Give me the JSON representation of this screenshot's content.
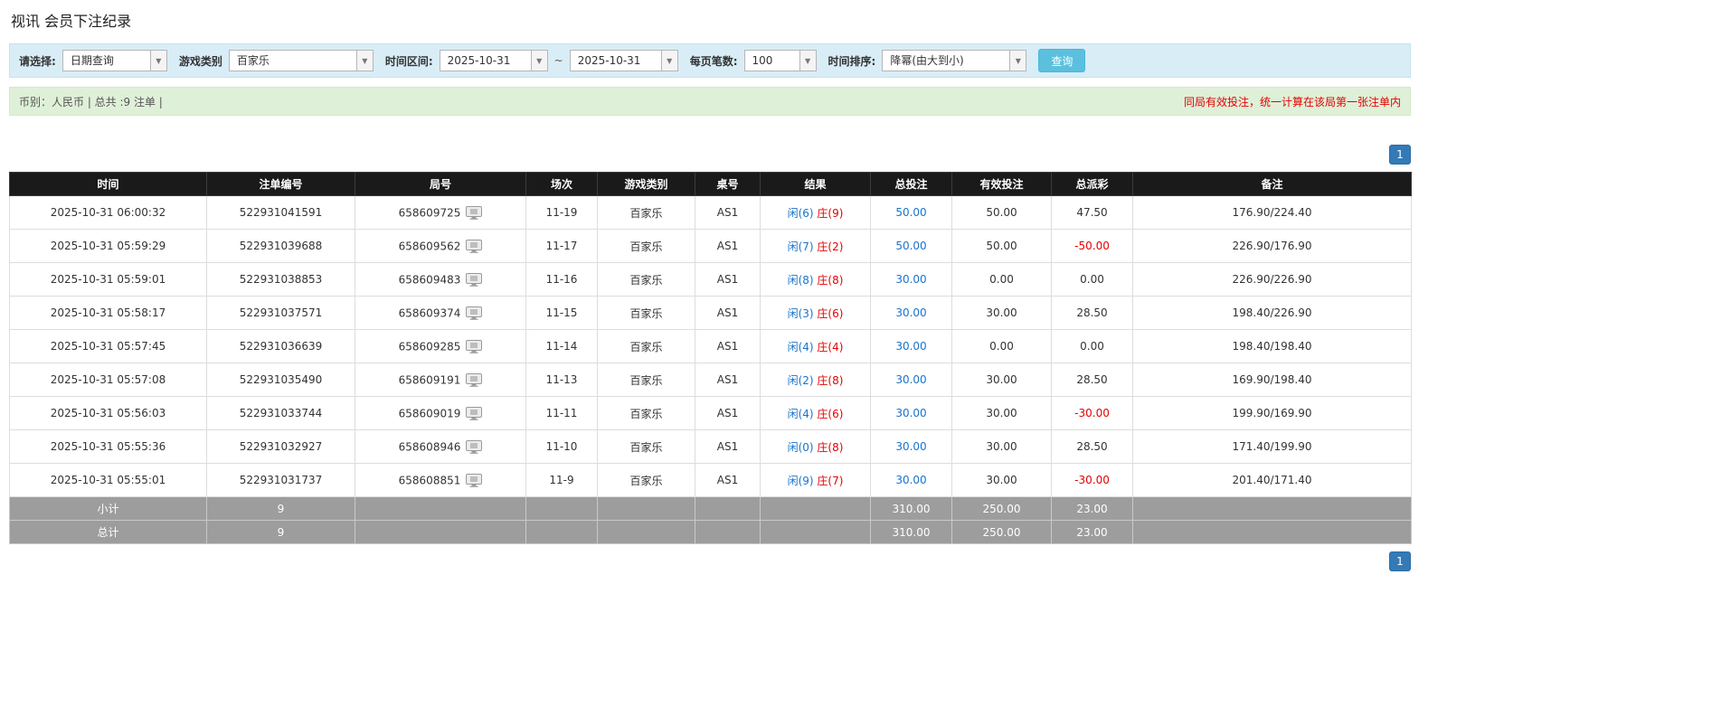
{
  "page": {
    "title": "视讯 会员下注纪录"
  },
  "colors": {
    "link_blue": "#1874cd",
    "banker_red": "#e60000",
    "header_bg": "#1a1a1a",
    "footer_bg": "#9d9d9d",
    "filter_bar_bg": "#d9edf7",
    "info_bar_bg": "#dff0d8",
    "search_button_bg": "#5bc0de",
    "pagination_bg": "#337ab7"
  },
  "filters": {
    "query_type": {
      "label": "请选择:",
      "value": "日期查询"
    },
    "game_type": {
      "label": "游戏类别",
      "value": "百家乐"
    },
    "date_range": {
      "label": "时间区间:",
      "from": "2025-10-31",
      "separator": "~",
      "to": "2025-10-31"
    },
    "page_size": {
      "label": "每页笔数:",
      "value": "100"
    },
    "sort_order": {
      "label": "时间排序:",
      "value": "降幂(由大到小)"
    },
    "search_button_label": "查询"
  },
  "info_bar": {
    "left": "币别：人民币 | 总共 :9 注单 |",
    "right": "同局有效投注，统一计算在该局第一张注单内"
  },
  "pagination": {
    "page": "1"
  },
  "table": {
    "headers": [
      "时间",
      "注单编号",
      "局号",
      "场次",
      "游戏类别",
      "桌号",
      "结果",
      "总投注",
      "有效投注",
      "总派彩",
      "备注"
    ],
    "rows": [
      {
        "time": "2025-10-31 06:00:32",
        "bet_id": "522931041591",
        "round_id": "658609725",
        "session": "11-19",
        "game": "百家乐",
        "table_no": "AS1",
        "result_player": "闲(6)",
        "result_banker": "庄(9)",
        "total_bet": "50.00",
        "valid_bet": "50.00",
        "payout": "47.50",
        "remark": "176.90/224.40"
      },
      {
        "time": "2025-10-31 05:59:29",
        "bet_id": "522931039688",
        "round_id": "658609562",
        "session": "11-17",
        "game": "百家乐",
        "table_no": "AS1",
        "result_player": "闲(7)",
        "result_banker": "庄(2)",
        "total_bet": "50.00",
        "valid_bet": "50.00",
        "payout": "-50.00",
        "remark": "226.90/176.90"
      },
      {
        "time": "2025-10-31 05:59:01",
        "bet_id": "522931038853",
        "round_id": "658609483",
        "session": "11-16",
        "game": "百家乐",
        "table_no": "AS1",
        "result_player": "闲(8)",
        "result_banker": "庄(8)",
        "total_bet": "30.00",
        "valid_bet": "0.00",
        "payout": "0.00",
        "remark": "226.90/226.90"
      },
      {
        "time": "2025-10-31 05:58:17",
        "bet_id": "522931037571",
        "round_id": "658609374",
        "session": "11-15",
        "game": "百家乐",
        "table_no": "AS1",
        "result_player": "闲(3)",
        "result_banker": "庄(6)",
        "total_bet": "30.00",
        "valid_bet": "30.00",
        "payout": "28.50",
        "remark": "198.40/226.90"
      },
      {
        "time": "2025-10-31 05:57:45",
        "bet_id": "522931036639",
        "round_id": "658609285",
        "session": "11-14",
        "game": "百家乐",
        "table_no": "AS1",
        "result_player": "闲(4)",
        "result_banker": "庄(4)",
        "total_bet": "30.00",
        "valid_bet": "0.00",
        "payout": "0.00",
        "remark": "198.40/198.40"
      },
      {
        "time": "2025-10-31 05:57:08",
        "bet_id": "522931035490",
        "round_id": "658609191",
        "session": "11-13",
        "game": "百家乐",
        "table_no": "AS1",
        "result_player": "闲(2)",
        "result_banker": "庄(8)",
        "total_bet": "30.00",
        "valid_bet": "30.00",
        "payout": "28.50",
        "remark": "169.90/198.40"
      },
      {
        "time": "2025-10-31 05:56:03",
        "bet_id": "522931033744",
        "round_id": "658609019",
        "session": "11-11",
        "game": "百家乐",
        "table_no": "AS1",
        "result_player": "闲(4)",
        "result_banker": "庄(6)",
        "total_bet": "30.00",
        "valid_bet": "30.00",
        "payout": "-30.00",
        "remark": "199.90/169.90"
      },
      {
        "time": "2025-10-31 05:55:36",
        "bet_id": "522931032927",
        "round_id": "658608946",
        "session": "11-10",
        "game": "百家乐",
        "table_no": "AS1",
        "result_player": "闲(0)",
        "result_banker": "庄(8)",
        "total_bet": "30.00",
        "valid_bet": "30.00",
        "payout": "28.50",
        "remark": "171.40/199.90"
      },
      {
        "time": "2025-10-31 05:55:01",
        "bet_id": "522931031737",
        "round_id": "658608851",
        "session": "11-9",
        "game": "百家乐",
        "table_no": "AS1",
        "result_player": "闲(9)",
        "result_banker": "庄(7)",
        "total_bet": "30.00",
        "valid_bet": "30.00",
        "payout": "-30.00",
        "remark": "201.40/171.40"
      }
    ],
    "subtotal": {
      "label": "小计",
      "count": "9",
      "total_bet": "310.00",
      "valid_bet": "250.00",
      "payout": "23.00"
    },
    "total": {
      "label": "总计",
      "count": "9",
      "total_bet": "310.00",
      "valid_bet": "250.00",
      "payout": "23.00"
    }
  }
}
